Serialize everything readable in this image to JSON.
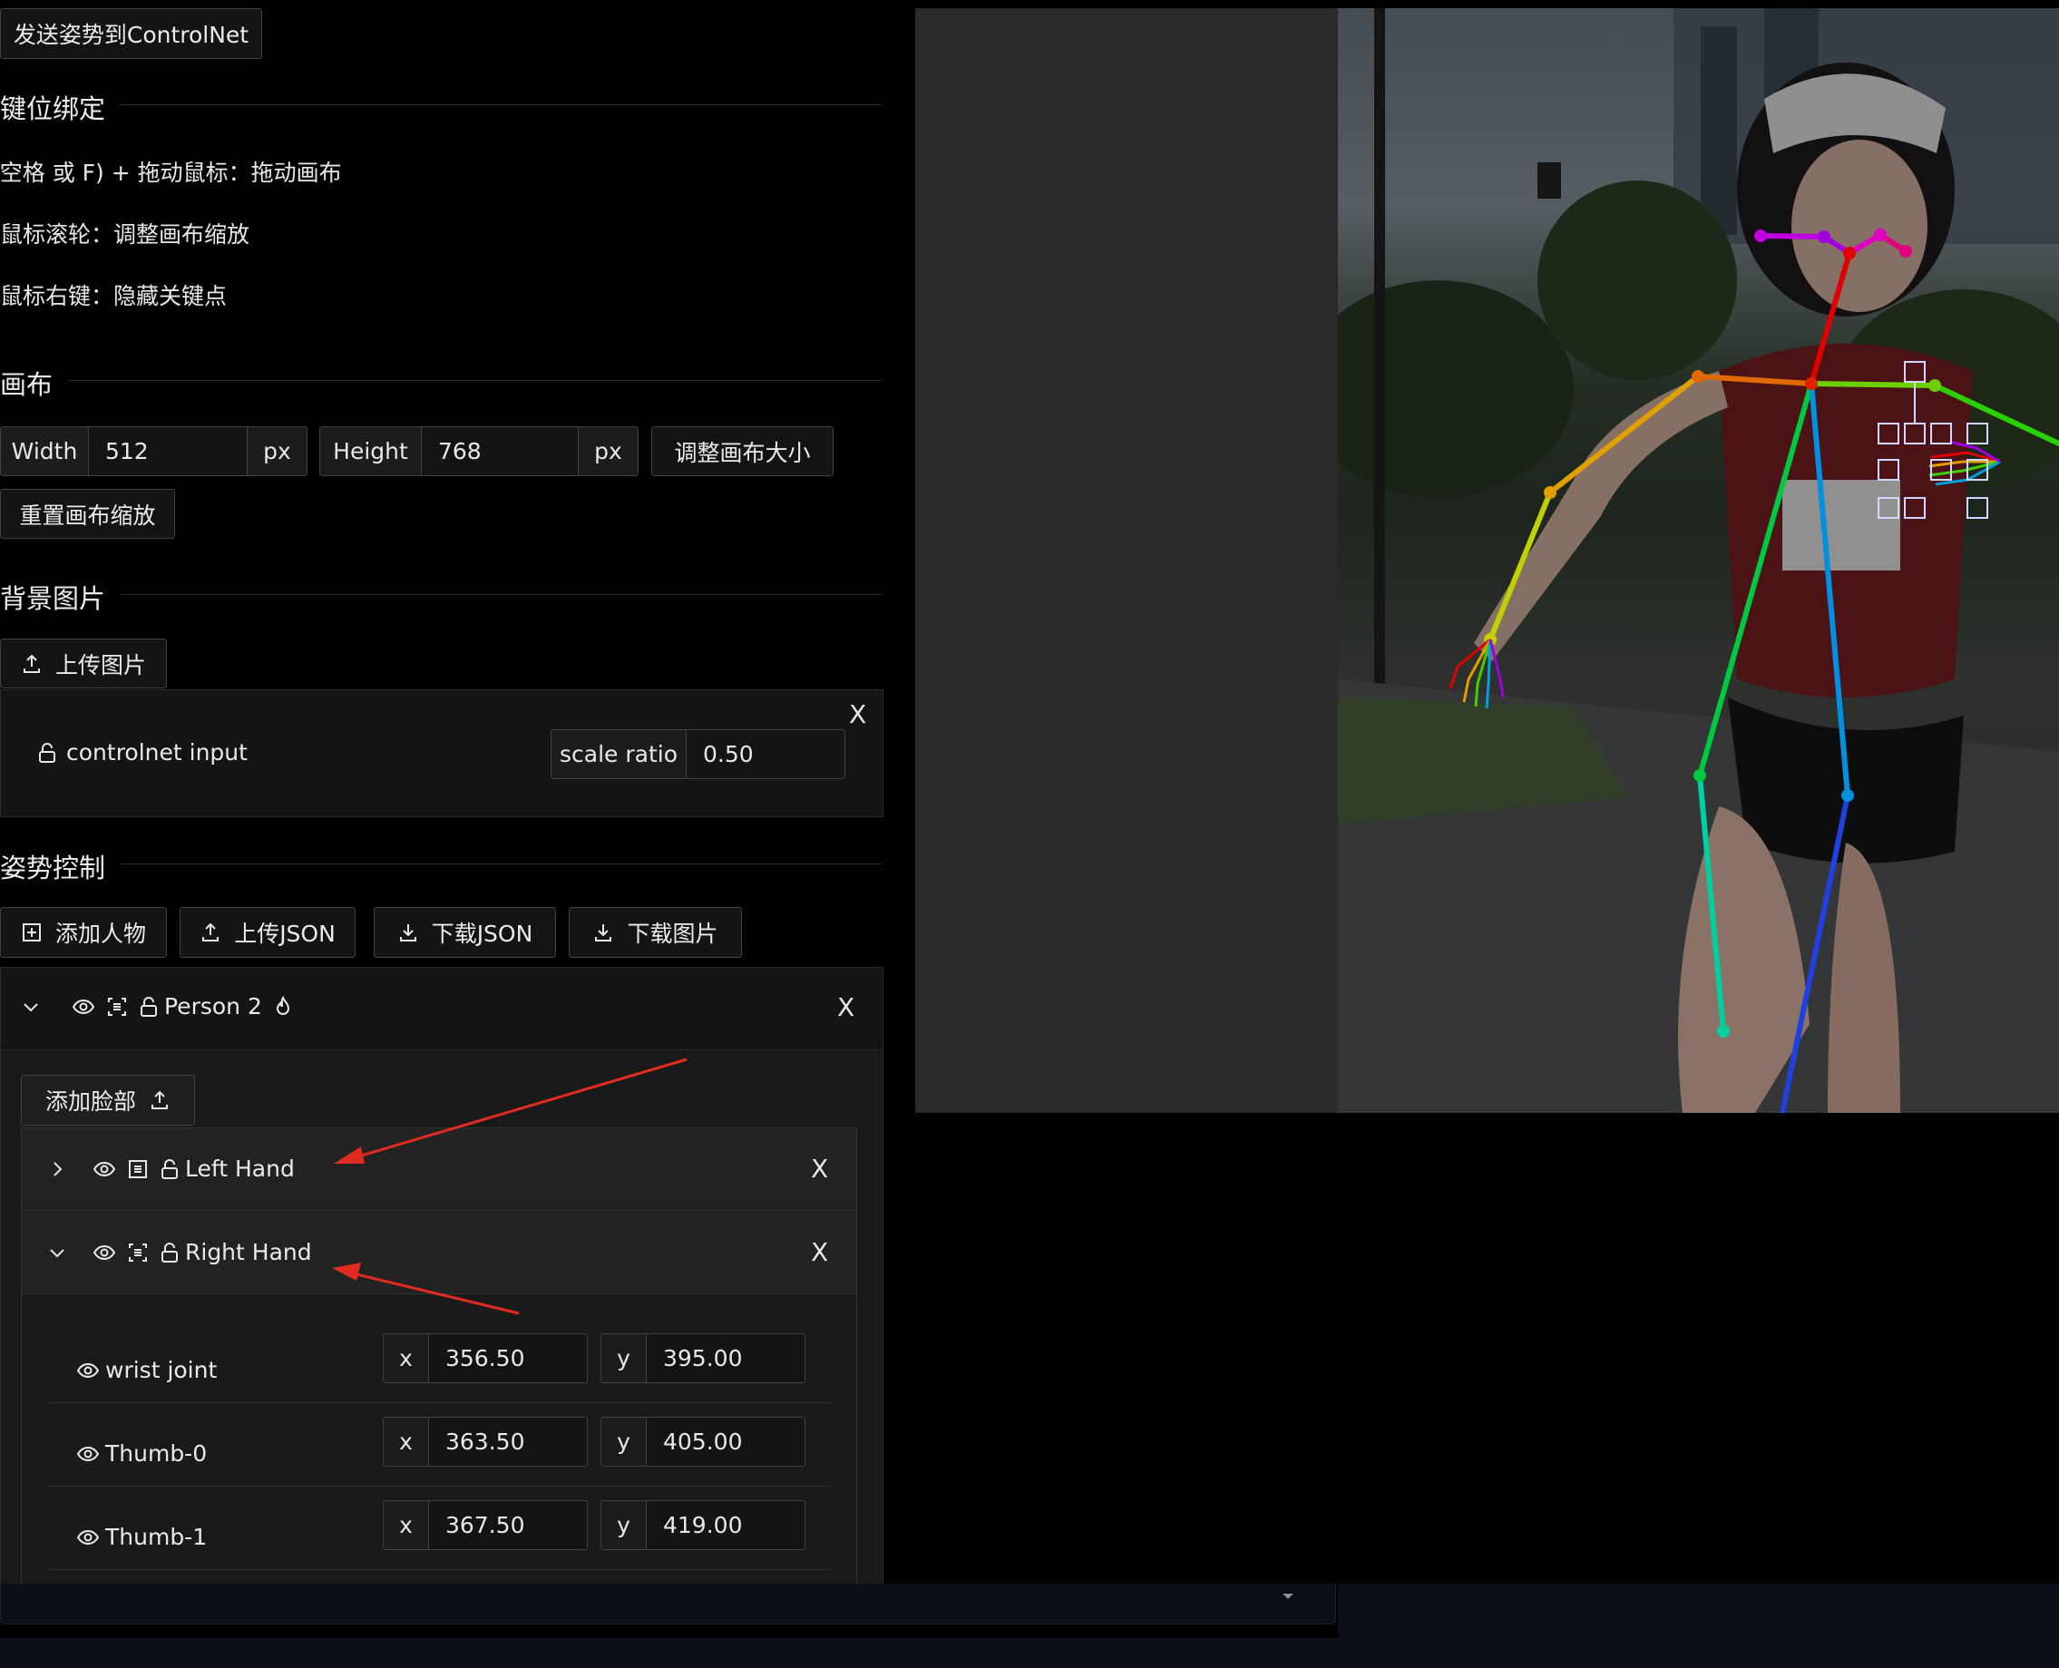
{
  "send_button": "发送姿势到ControlNet",
  "keybind": {
    "title": "键位绑定",
    "lines": [
      "(空格 或 F) + 拖动鼠标：拖动画布",
      "鼠标滚轮：调整画布缩放",
      "鼠标右键：隐藏关键点"
    ]
  },
  "canvas": {
    "title": "画布",
    "width_label": "Width",
    "width_value": "512",
    "height_label": "Height",
    "height_value": "768",
    "unit": "px",
    "resize_button": "调整画布大小",
    "reset_zoom_button": "重置画布缩放"
  },
  "background": {
    "title": "背景图片",
    "upload_button": "上传图片",
    "layer_name": "controlnet input",
    "scale_label": "scale ratio",
    "scale_value": "0.50",
    "close": "X"
  },
  "pose": {
    "title": "姿势控制",
    "add_person": "添加人物",
    "upload_json": "上传JSON",
    "download_json": "下载JSON",
    "download_image": "下载图片",
    "person_name": "Person 2",
    "add_face": "添加脸部",
    "left_hand": "Left Hand",
    "right_hand": "Right Hand",
    "close": "X",
    "x_label": "x",
    "y_label": "y",
    "keypoints": [
      {
        "name": "wrist joint",
        "x": "356.50",
        "y": "395.00"
      },
      {
        "name": "Thumb-0",
        "x": "363.50",
        "y": "405.00"
      },
      {
        "name": "Thumb-1",
        "x": "367.50",
        "y": "419.00"
      }
    ]
  },
  "colors": {
    "accent": "#e02b20",
    "bg": "#000000",
    "panel": "#191919"
  }
}
